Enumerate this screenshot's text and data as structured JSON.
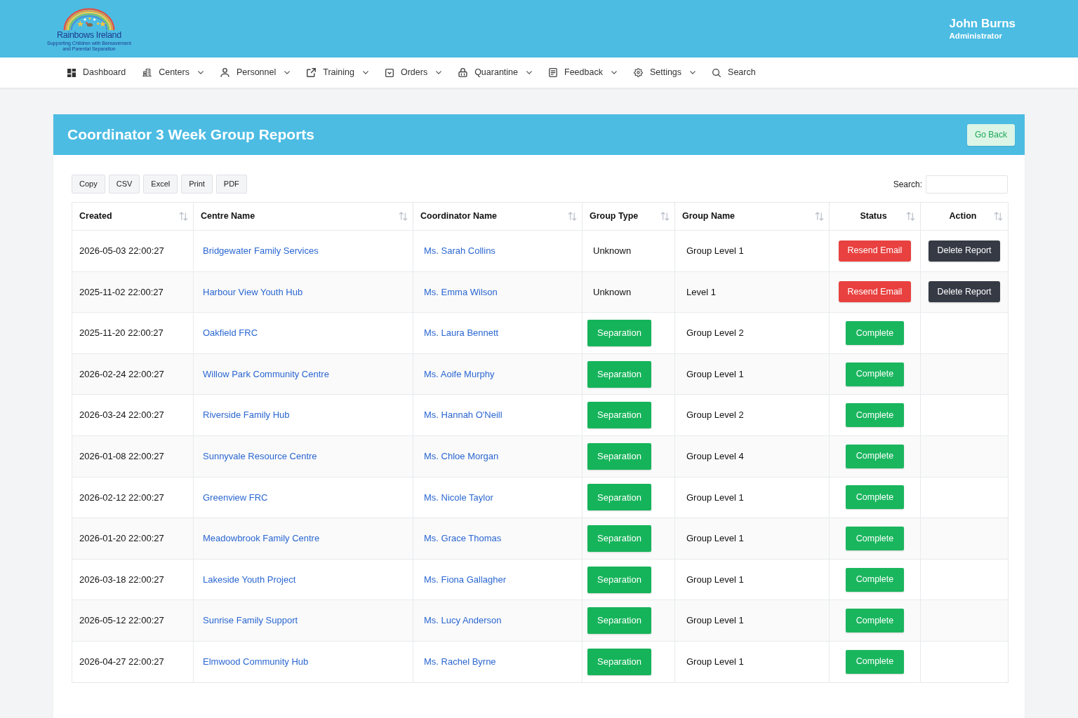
{
  "header": {
    "logo": {
      "title": "Rainbows Ireland",
      "tagline": [
        "Supporting Children with Bereavement",
        "and Parental Separation"
      ]
    },
    "user": {
      "name": "John Burns",
      "role": "Administrator"
    }
  },
  "nav": [
    {
      "label": "Dashboard",
      "dropdown": false
    },
    {
      "label": "Centers",
      "dropdown": true
    },
    {
      "label": "Personnel",
      "dropdown": true
    },
    {
      "label": "Training",
      "dropdown": true
    },
    {
      "label": "Orders",
      "dropdown": true
    },
    {
      "label": "Quarantine",
      "dropdown": true
    },
    {
      "label": "Feedback",
      "dropdown": true
    },
    {
      "label": "Settings",
      "dropdown": true
    },
    {
      "label": "Search",
      "dropdown": false
    }
  ],
  "panel": {
    "title": "Coordinator 3 Week Group Reports",
    "back_button": "Go Back",
    "export_buttons": [
      "Copy",
      "CSV",
      "Excel",
      "Print",
      "PDF"
    ],
    "search": {
      "label": "Search:"
    },
    "table": {
      "columns": [
        "Created",
        "Centre Name",
        "Coordinator Name",
        "Group Type",
        "Group Name",
        "Status",
        "Action"
      ],
      "rows": [
        {
          "created": "2026-05-03 22:00:27",
          "centre": "Bridgewater Family Services",
          "coordinator": "Ms. Sarah Collins",
          "group_type": {
            "kind": "plain",
            "label": "Unknown"
          },
          "group_name": "Group Level 1",
          "status": {
            "kind": "button",
            "label": "Resend Email"
          },
          "action": {
            "label": "Delete Report"
          }
        },
        {
          "created": "2025-11-02 22:00:27",
          "centre": "Harbour View Youth Hub",
          "coordinator": "Ms. Emma Wilson",
          "group_type": {
            "kind": "plain",
            "label": "Unknown"
          },
          "group_name": "Level 1",
          "status": {
            "kind": "button",
            "label": "Resend Email"
          },
          "action": {
            "label": "Delete Report"
          }
        },
        {
          "created": "2025-11-20 22:00:27",
          "centre": "Oakfield FRC",
          "coordinator": "Ms. Laura Bennett",
          "group_type": {
            "kind": "tag",
            "label": "Separation"
          },
          "group_name": "Group Level 2",
          "status": {
            "kind": "badge",
            "label": "Complete"
          }
        },
        {
          "created": "2026-02-24 22:00:27",
          "centre": "Willow Park Community Centre",
          "coordinator": "Ms. Aoife Murphy",
          "group_type": {
            "kind": "tag",
            "label": "Separation"
          },
          "group_name": "Group Level 1",
          "status": {
            "kind": "badge",
            "label": "Complete"
          }
        },
        {
          "created": "2026-03-24 22:00:27",
          "centre": "Riverside Family Hub",
          "coordinator": "Ms. Hannah O'Neill",
          "group_type": {
            "kind": "tag",
            "label": "Separation"
          },
          "group_name": "Group Level 2",
          "status": {
            "kind": "badge",
            "label": "Complete"
          }
        },
        {
          "created": "2026-01-08 22:00:27",
          "centre": "Sunnyvale Resource Centre",
          "coordinator": "Ms. Chloe Morgan",
          "group_type": {
            "kind": "tag",
            "label": "Separation"
          },
          "group_name": "Group Level 4",
          "status": {
            "kind": "badge",
            "label": "Complete"
          }
        },
        {
          "created": "2026-02-12 22:00:27",
          "centre": "Greenview FRC",
          "coordinator": "Ms. Nicole Taylor",
          "group_type": {
            "kind": "tag",
            "label": "Separation"
          },
          "group_name": "Group Level 1",
          "status": {
            "kind": "badge",
            "label": "Complete"
          }
        },
        {
          "created": "2026-01-20 22:00:27",
          "centre": "Meadowbrook Family Centre",
          "coordinator": "Ms. Grace Thomas",
          "group_type": {
            "kind": "tag",
            "label": "Separation"
          },
          "group_name": "Group Level 1",
          "status": {
            "kind": "badge",
            "label": "Complete"
          }
        },
        {
          "created": "2026-03-18 22:00:27",
          "centre": "Lakeside Youth Project",
          "coordinator": "Ms. Fiona Gallagher",
          "group_type": {
            "kind": "tag",
            "label": "Separation"
          },
          "group_name": "Group Level 1",
          "status": {
            "kind": "badge",
            "label": "Complete"
          }
        },
        {
          "created": "2026-05-12 22:00:27",
          "centre": "Sunrise Family Support",
          "coordinator": "Ms. Lucy Anderson",
          "group_type": {
            "kind": "tag",
            "label": "Separation"
          },
          "group_name": "Group Level 1",
          "status": {
            "kind": "badge",
            "label": "Complete"
          }
        },
        {
          "created": "2026-04-27 22:00:27",
          "centre": "Elmwood Community Hub",
          "coordinator": "Ms. Rachel Byrne",
          "group_type": {
            "kind": "tag",
            "label": "Separation"
          },
          "group_name": "Group Level 1",
          "status": {
            "kind": "badge",
            "label": "Complete"
          }
        }
      ]
    }
  }
}
